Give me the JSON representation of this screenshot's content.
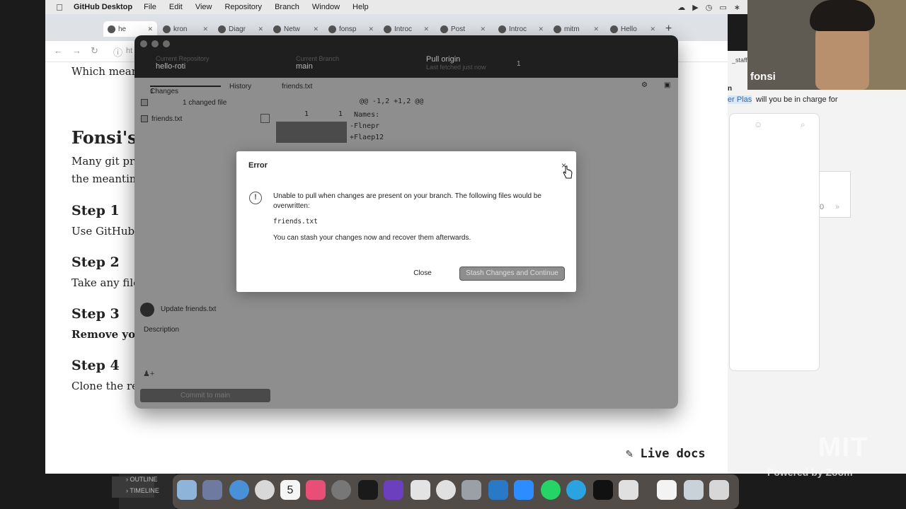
{
  "menubar": {
    "app_name": "GitHub Desktop",
    "items": [
      "File",
      "Edit",
      "View",
      "Repository",
      "Branch",
      "Window",
      "Help"
    ]
  },
  "browser": {
    "tabs": [
      {
        "label": "he"
      },
      {
        "label": "kron"
      },
      {
        "label": "Diagr"
      },
      {
        "label": "Netw"
      },
      {
        "label": "fonsp"
      },
      {
        "label": "Introc"
      },
      {
        "label": "Post"
      },
      {
        "label": "Introc"
      },
      {
        "label": "mitm"
      },
      {
        "label": "Hello"
      }
    ],
    "new_tab": "+",
    "address_prefix": "ht"
  },
  "doc": {
    "intro": "Which mean",
    "heading": "Fonsi's",
    "para_line1": "Many git pro",
    "para_line2": "the meantim",
    "steps": [
      {
        "title": "Step 1",
        "text": "Use GitHub D"
      },
      {
        "title": "Step 2",
        "text": "Take any files"
      },
      {
        "title": "Step 3",
        "text": "Remove you"
      },
      {
        "title": "Step 4",
        "text": "Clone the rep"
      }
    ],
    "live_docs": "Live docs"
  },
  "chat": {
    "staff": "_staff",
    "name_frag": "n",
    "question": "will you be in charge for",
    "mention": "er Plas",
    "page_num": "0"
  },
  "webcam": {
    "name": "fonsi"
  },
  "github_desktop": {
    "repo_label": "Current Repository",
    "repo": "hello-roti",
    "branch_label": "Current Branch",
    "branch": "main",
    "pull_title": "Pull origin",
    "pull_sub": "Last fetched just now",
    "pull_count": "1",
    "tabs": {
      "changes": "Changes",
      "changes_count": "1",
      "history": "History"
    },
    "file_tab": "friends.txt",
    "changed_files": "1 changed file",
    "file_name": "friends.txt",
    "hunk": "@@ -1,2 +1,2 @@",
    "diff_lines": [
      "Names:",
      "-Flnepr",
      "+Flaep12"
    ],
    "line_nums": [
      "1",
      "1"
    ],
    "commit_summary": "Update friends.txt",
    "description": "Description",
    "commit_button": "Commit to main"
  },
  "dialog": {
    "title": "Error",
    "close_glyph": "×",
    "info_glyph": "!",
    "message": "Unable to pull when changes are present on your branch. The following files would be overwritten:",
    "file": "friends.txt",
    "stash_note": "You can stash your changes now and recover them afterwards.",
    "close_button": "Close",
    "stash_button": "Stash Changes and Continue"
  },
  "dock": {
    "outline": "OUTLINE",
    "timeline": "TIMELINE",
    "calendar_day": "5"
  },
  "watermark": {
    "logo": "MIT",
    "powered": "Powered by Zoom"
  },
  "colors": {
    "dialog_bg": "#ffffff",
    "overlay": "#8e8e8e",
    "titlebar": "#1f1f1f"
  }
}
